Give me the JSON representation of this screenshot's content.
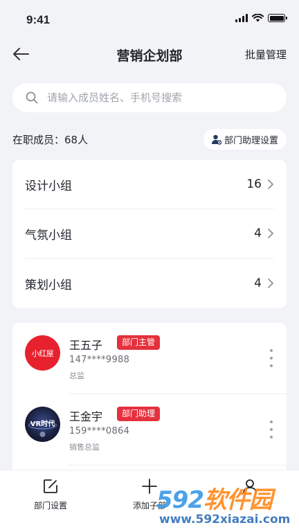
{
  "status_bar": {
    "time": "9:41"
  },
  "nav": {
    "title": "营销企划部",
    "batch_label": "批量管理"
  },
  "search": {
    "placeholder": "请输入成员姓名、手机号搜索"
  },
  "summary": {
    "member_count_text": "在职成员：68人",
    "assistant_settings_label": "部门助理设置"
  },
  "groups": [
    {
      "name": "设计小组",
      "count": "16"
    },
    {
      "name": "气氛小组",
      "count": "4"
    },
    {
      "name": "策划小组",
      "count": "4"
    }
  ],
  "members": [
    {
      "name": "王五子",
      "tag": "部门主管",
      "phone": "147****9988",
      "title": "总监",
      "avatar_text": "小红屋"
    },
    {
      "name": "王金宇",
      "tag": "部门助理",
      "phone": "159****0864",
      "title": "销售总监",
      "avatar_text": "VR时代"
    }
  ],
  "tabs": [
    {
      "label": "部门设置",
      "icon": "edit-icon"
    },
    {
      "label": "添加子部",
      "icon": "plus-icon"
    },
    {
      "label": "",
      "icon": "person-icon"
    }
  ],
  "watermark": {
    "brand_num": "592",
    "brand_cn": "软件园",
    "url": "www.592xiazai.com"
  },
  "colors": {
    "accent_red": "#e5303d",
    "background": "#f2f3f7"
  }
}
